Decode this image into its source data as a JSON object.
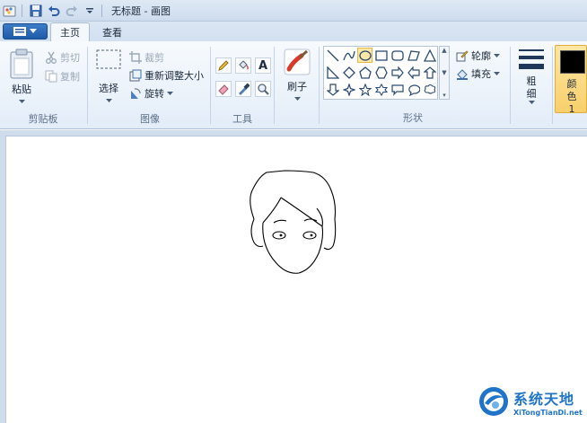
{
  "titlebar": {
    "title": "无标题 - 画图"
  },
  "tabs": [
    {
      "label": "主页"
    },
    {
      "label": "查看"
    }
  ],
  "clipboard": {
    "paste": "粘贴",
    "cut": "剪切",
    "copy": "复制",
    "label": "剪贴板"
  },
  "image": {
    "select": "选择",
    "crop": "裁剪",
    "resize": "重新调整大小",
    "rotate": "旋转",
    "label": "图像"
  },
  "tools": {
    "label": "工具"
  },
  "brush": {
    "label": "刷子"
  },
  "shapes": {
    "outline": "轮廓",
    "fill": "填充",
    "label": "形状"
  },
  "size": {
    "label": "粗细"
  },
  "color1": {
    "label": "颜色 1",
    "value": "#000000"
  },
  "watermark": {
    "name": "系统天地",
    "url": "XiTongTianDi.net"
  },
  "colors": {
    "accent": "#1d5aa8",
    "selected": "#fde7a6"
  }
}
